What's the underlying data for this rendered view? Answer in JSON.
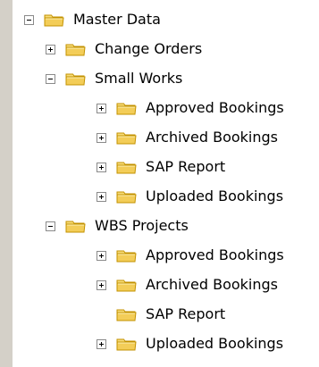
{
  "tree": {
    "items": [
      {
        "label": "Master Data",
        "expanded": true,
        "toggle": "minus",
        "icon": "folder-icon"
      },
      {
        "label": "Change Orders",
        "expanded": false,
        "toggle": "plus",
        "icon": "folder-icon"
      },
      {
        "label": "Small Works",
        "expanded": true,
        "toggle": "minus",
        "icon": "folder-icon"
      },
      {
        "label": "Approved Bookings",
        "expanded": false,
        "toggle": "plus",
        "icon": "folder-icon"
      },
      {
        "label": "Archived Bookings",
        "expanded": false,
        "toggle": "plus",
        "icon": "folder-icon"
      },
      {
        "label": "SAP Report",
        "expanded": false,
        "toggle": "plus",
        "icon": "folder-icon"
      },
      {
        "label": "Uploaded Bookings",
        "expanded": false,
        "toggle": "plus",
        "icon": "folder-icon"
      },
      {
        "label": "WBS Projects",
        "expanded": true,
        "toggle": "minus",
        "icon": "folder-icon"
      },
      {
        "label": "Approved Bookings",
        "expanded": false,
        "toggle": "plus",
        "icon": "folder-icon"
      },
      {
        "label": "Archived Bookings",
        "expanded": false,
        "toggle": "plus",
        "icon": "folder-icon"
      },
      {
        "label": "SAP Report",
        "expanded": false,
        "toggle": "none",
        "icon": "folder-icon"
      },
      {
        "label": "Uploaded Bookings",
        "expanded": false,
        "toggle": "plus",
        "icon": "folder-icon"
      }
    ]
  },
  "colors": {
    "folder_fill": "#f4d56a",
    "folder_outline": "#b48a00",
    "toggle_border": "#8a8a8a",
    "sidebar_strip": "#d4d0c8"
  }
}
